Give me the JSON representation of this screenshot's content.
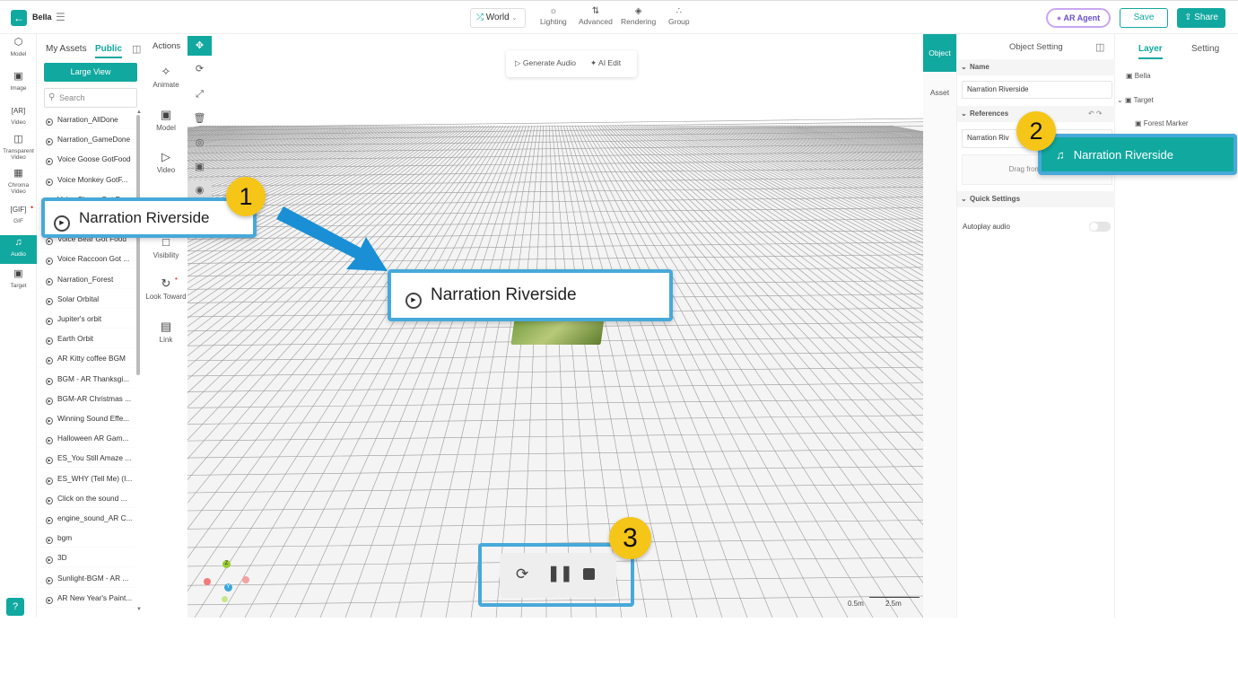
{
  "app": {
    "name": "Bella"
  },
  "topbar": {
    "world_label": "World",
    "nav": [
      "Lighting",
      "Advanced",
      "Rendering",
      "Group"
    ],
    "ar_agent_label": "AR Agent",
    "save_label": "Save",
    "share_label": "Share"
  },
  "rail": [
    {
      "label": "Model",
      "icon": "cube-icon"
    },
    {
      "label": "Image",
      "icon": "image-icon"
    },
    {
      "label": "Video",
      "icon": "ar-video-icon"
    },
    {
      "label": "Transparent Video",
      "icon": "transparent-video-icon"
    },
    {
      "label": "Chroma Video",
      "icon": "chroma-video-icon"
    },
    {
      "label": "GIF",
      "icon": "gif-icon"
    },
    {
      "label": "Audio",
      "icon": "music-note-icon"
    },
    {
      "label": "Target",
      "icon": "target-icon"
    }
  ],
  "assets": {
    "tab_my": "My Assets",
    "tab_public": "Public",
    "large_view": "Large View",
    "search_placeholder": "Search",
    "items": [
      "Narration_AllDone",
      "Narration_GameDone",
      "Voice Goose GotFood",
      "Voice Monkey GotF...",
      "Voice Sheep Got Fo...",
      "Narration Riverside",
      "Voice Bear Got Food",
      "Voice Raccoon Got ...",
      "Narration_Forest",
      "Solar Orbital",
      "Jupiter's orbit",
      "Earth Orbit",
      "AR Kitty coffee BGM",
      "BGM - AR Thanksgi...",
      "BGM-AR Christmas ...",
      "Winning Sound Effe...",
      "Halloween AR Gam...",
      "ES_You Still Amaze ...",
      "ES_WHY (Tell Me) (I...",
      "Click on the sound ...",
      "engine_sound_AR C...",
      "bgm",
      "3D",
      "Sunlight-BGM - AR ...",
      "AR New Year's Paint..."
    ]
  },
  "actions": {
    "title": "Actions",
    "items": [
      "Animate",
      "Model",
      "Video",
      "Visibility",
      "Look Toward",
      "Link"
    ]
  },
  "viewport": {
    "generate_audio": "Generate Audio",
    "ai_edit": "AI Edit",
    "scale_a": "0.5m",
    "scale_b": "2.5m",
    "axis_y": "Y",
    "axis_z": "Z"
  },
  "object_tabs": [
    "Object",
    "Asset"
  ],
  "object_setting": {
    "title": "Object Setting",
    "name_section": "Name",
    "name_value": "Narration Riverside",
    "references_section": "References",
    "reference_value": "Narration Riv",
    "drag_hint": "Drag from asset li",
    "quick_settings_section": "Quick Settings",
    "autoplay_label": "Autoplay audio"
  },
  "layer": {
    "tab_layer": "Layer",
    "tab_setting": "Setting",
    "items": [
      "Bella",
      "Target",
      "Forest Marker"
    ]
  },
  "callouts": {
    "one_label": "Narration Riverside",
    "two_label": "Narration Riverside",
    "center_label": "Narration Riverside",
    "badge_1": "1",
    "badge_2": "2",
    "badge_3": "3"
  },
  "colors": {
    "accent": "#11a89f",
    "callout_border": "#47a9d9",
    "badge": "#f5c518",
    "arrow": "#1a8fd6"
  }
}
